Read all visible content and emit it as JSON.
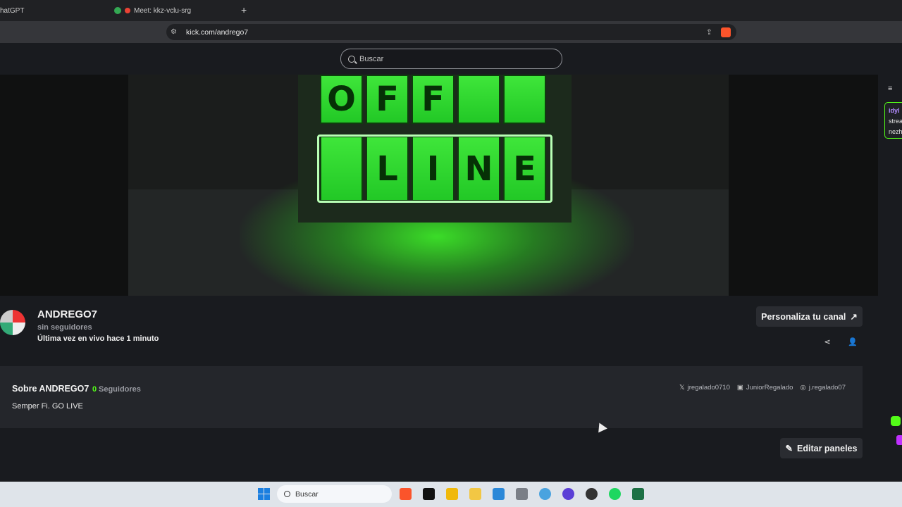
{
  "browser": {
    "tabs": [
      {
        "label": "hatGPT"
      },
      {
        "label": "Meet: kkz-vclu-srg"
      }
    ],
    "new_tab_label": "+",
    "url": "kick.com/andrego7"
  },
  "nav": {
    "search_placeholder": "Buscar"
  },
  "banner": {
    "row1": [
      "O",
      "F",
      "F",
      "",
      ""
    ],
    "row2": [
      "",
      "L",
      "I",
      "N",
      "E"
    ],
    "colors": {
      "tile": "#3fe63a",
      "glow": "#2fd62a"
    }
  },
  "channel": {
    "name": "ANDREGO7",
    "followers_text": "sin seguidores",
    "last_live": "Última vez en vivo hace 1 minuto",
    "customize_label": "Personaliza tu canal"
  },
  "about": {
    "title": "Sobre ANDREGO7",
    "follower_count": "0",
    "follower_label": "Seguidores",
    "bio": "Semper Fi. GO LIVE",
    "socials": [
      {
        "icon": "x-icon",
        "label": "jregalado0710"
      },
      {
        "icon": "facebook-icon",
        "label": "JuniorRegalado"
      },
      {
        "icon": "instagram-icon",
        "label": "j.regalado07"
      }
    ]
  },
  "edit_panels_label": "Editar paneles",
  "chat": {
    "user": "idyl",
    "lines": [
      "strea",
      "nezh"
    ]
  },
  "taskbar": {
    "search_placeholder": "Buscar"
  },
  "colors": {
    "accent": "#53fc18",
    "background": "#191b1f"
  }
}
